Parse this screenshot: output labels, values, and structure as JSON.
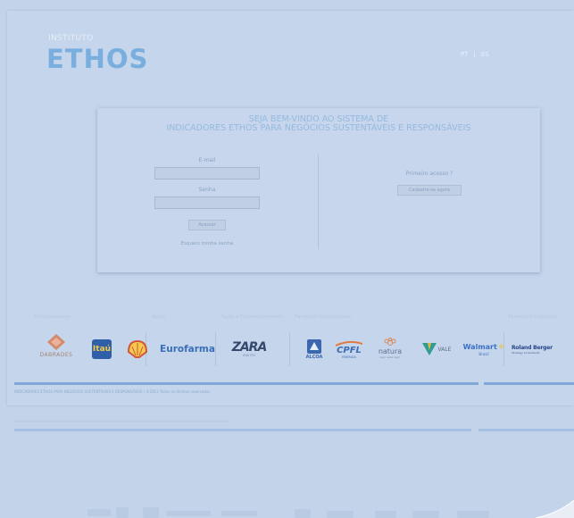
{
  "header": {
    "brand_small": "INSTITUTO",
    "brand_big": "ETHOS",
    "lang_pt": "PT",
    "lang_sep": "|",
    "lang_es": "ES"
  },
  "login": {
    "welcome_line1": "SEJA BEM-VINDO AO SISTEMA DE",
    "welcome_line2": "INDICADORES ETHOS PARA NEGÓCIOS SUSTENTÁVEIS E RESPONSÁVEIS",
    "email_label": "E-mail",
    "password_label": "Senha",
    "submit_label": "Acessar",
    "forgot_label": "Esqueci minha senha",
    "first_access_label": "Primeiro acesso ?",
    "register_label": "Cadastre-se agora"
  },
  "partners": {
    "categories": [
      "Patrocinadores",
      "Apoio",
      "Apoio a Desenvolvimento",
      "Parceiros Institucionais",
      "Parceiro Estratégico"
    ],
    "logos": {
      "dabrades": "DABRADES",
      "itau": "Itaú",
      "eurofarma": "Eurofarma",
      "zara": "ZARA",
      "zara_sub": "INDITEX",
      "alcoa": "ALCOA",
      "cpfl": "CPFL",
      "cpfl_sub": "ENERGIA",
      "natura": "natura",
      "natura_sub": "bem estar bem",
      "vale": "VALE",
      "walmart": "Walmart",
      "walmart_sub": "Brasil",
      "roland": "Roland Berger",
      "roland_sub": "Strategy Consultants"
    }
  },
  "footer": {
    "text": "INDICADORES ETHOS PARA NEGÓCIOS SUSTENTÁVEIS E RESPONSÁVEIS  |  ©2013 Todos os direitos reservados"
  },
  "colors": {
    "accent": "#7aaedf",
    "background": "#c3d3ea",
    "bar": "#7fa8d8"
  }
}
